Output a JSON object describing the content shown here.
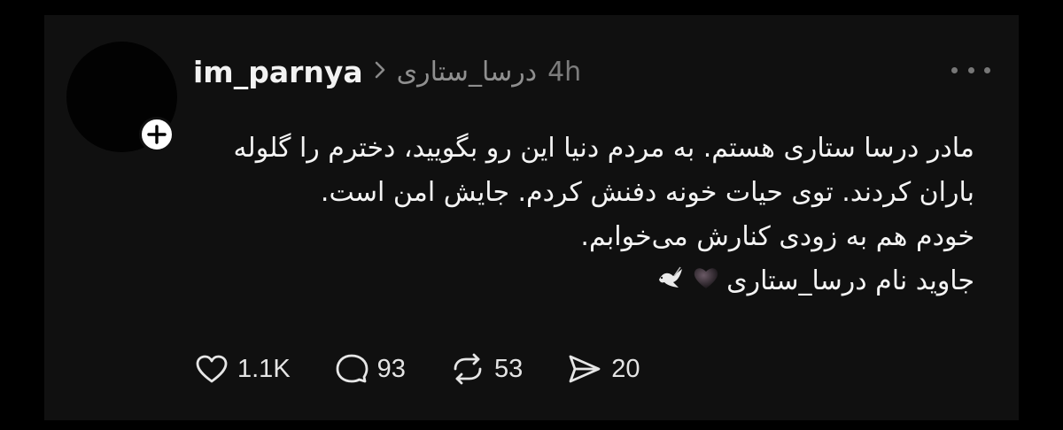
{
  "post": {
    "author": "im_parnya",
    "community": "درسا_ستاری",
    "time": "4h",
    "lines": [
      "مادر درسا ستاری هستم. به مردم دنیا این رو بگویید، دخترم را گلوله",
      "باران کردند. توی حیات خونه دفنش کردم. جایش امن است.",
      "خودم هم به زودی کنارش می‌خوابم.",
      "جاوید نام درسا_ستاری"
    ],
    "emojis": [
      "black-heart",
      "dove"
    ]
  },
  "actions": {
    "likes": "1.1K",
    "replies": "93",
    "reposts": "53",
    "shares": "20"
  },
  "icons": [
    "plus-icon",
    "chevron-right-icon",
    "more-icon",
    "heart-icon",
    "comment-icon",
    "repost-icon",
    "share-icon"
  ],
  "colors": {
    "page": "#000000",
    "card": "#101010",
    "text": "#f4f4f4",
    "muted": "#8f8f8f"
  }
}
